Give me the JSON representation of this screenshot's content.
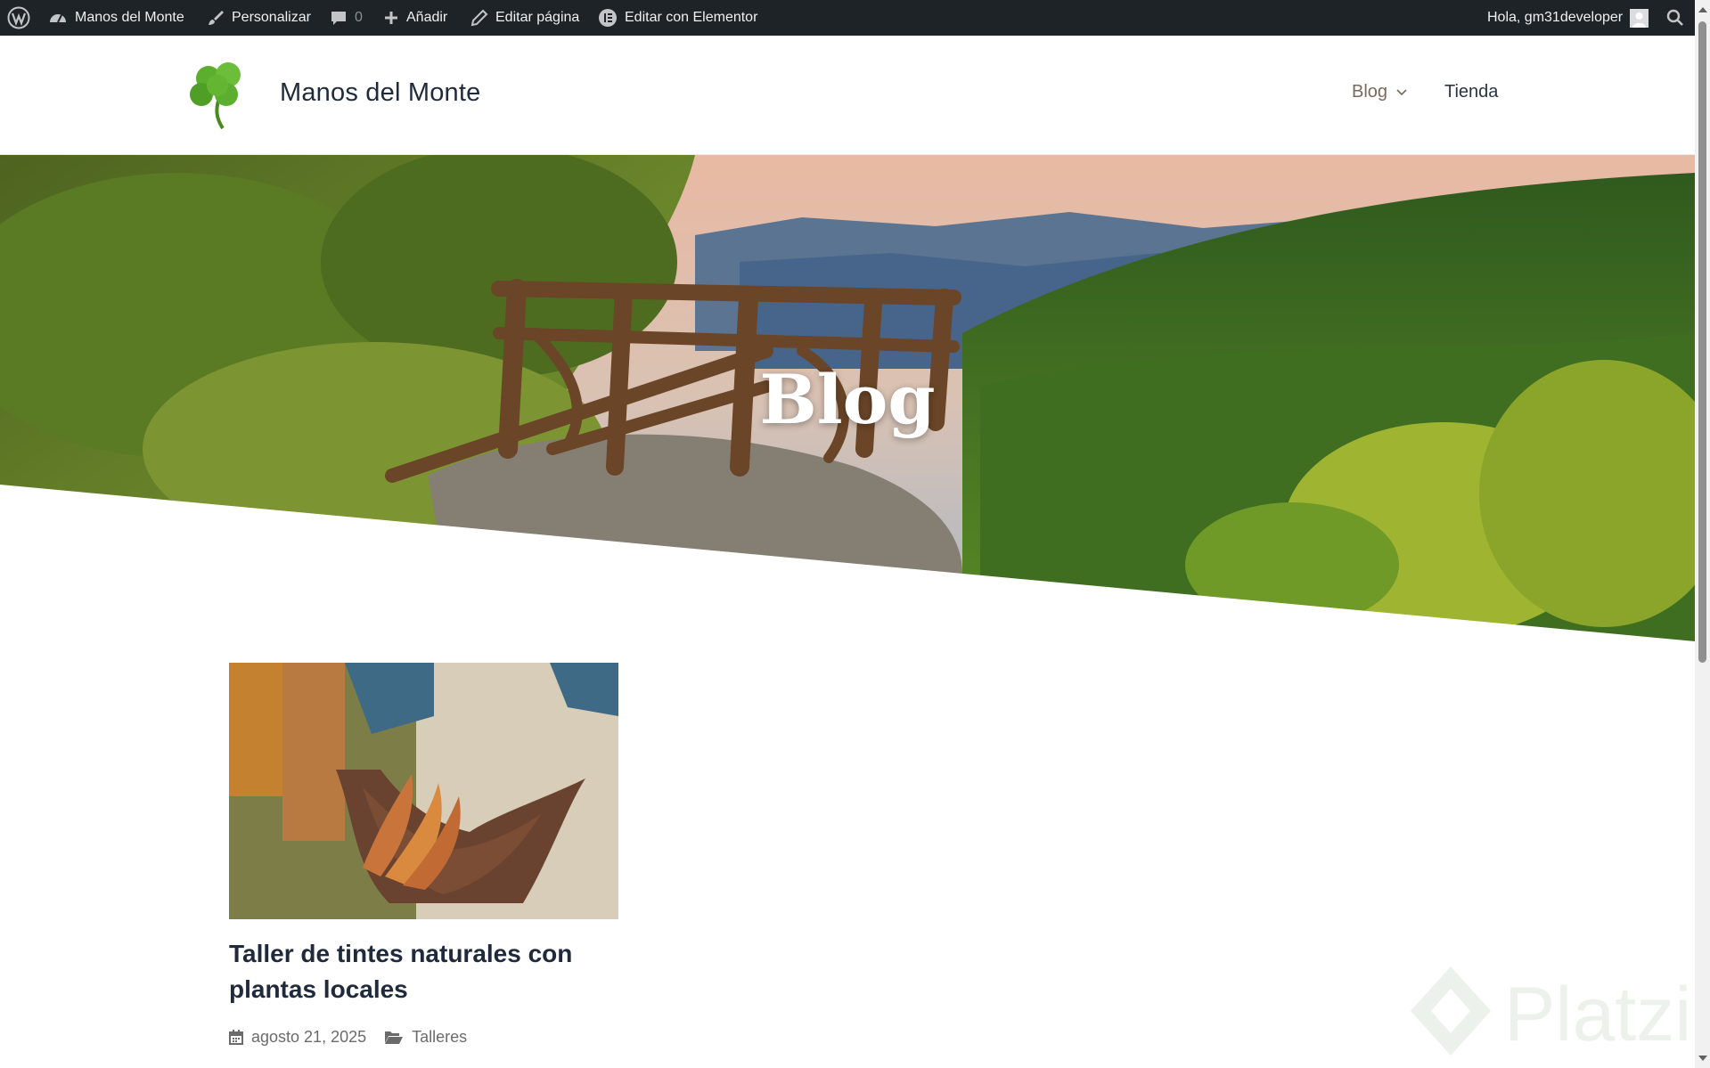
{
  "admin_bar": {
    "wp_logo_icon": "wordpress-icon",
    "site_name": "Manos del Monte",
    "customize": "Personalizar",
    "comments_count": "0",
    "add_new": "Añadir",
    "edit_page": "Editar página",
    "edit_elementor": "Editar con Elementor",
    "greeting": "Hola, gm31developer",
    "search_icon": "search-icon"
  },
  "header": {
    "logo_icon": "clover-icon",
    "site_title": "Manos del Monte",
    "nav": [
      {
        "label": "Blog",
        "has_dropdown": true
      },
      {
        "label": "Tienda",
        "has_dropdown": false
      }
    ]
  },
  "hero": {
    "title": "Blog"
  },
  "posts": [
    {
      "title": "Taller de tintes naturales con plantas locales",
      "date": "agosto 21, 2025",
      "category": "Talleres"
    }
  ],
  "watermark": {
    "text": "Platzi"
  },
  "colors": {
    "admin_bar_bg": "#1d2327",
    "title_color": "#1f2a3c",
    "nav_active": "#7a6a5c"
  }
}
